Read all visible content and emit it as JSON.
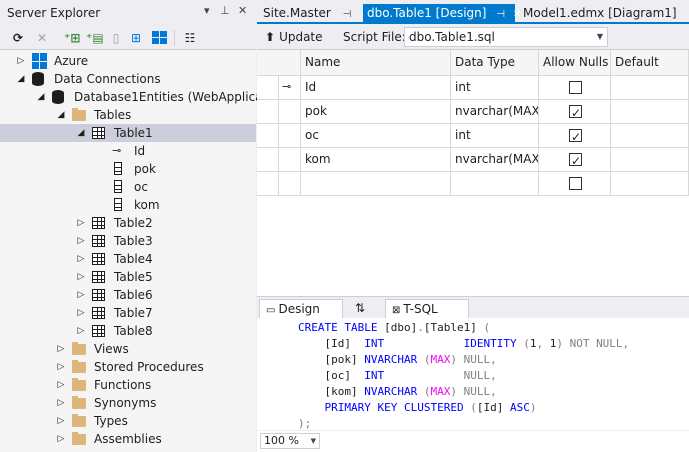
{
  "server_explorer": {
    "title": "Server Explorer",
    "title_controls": [
      "▾",
      "⊥",
      "✕"
    ],
    "toolbar_icons": [
      "refresh-icon",
      "stop-icon",
      "connect-to-database-icon",
      "connect-to-server-icon",
      "sharepoint-icon",
      "azure-icon",
      "properties-icon"
    ],
    "tree": [
      {
        "label": "Azure",
        "icon": "azure-icon",
        "level": 0,
        "arrow": "collapsed"
      },
      {
        "label": "Data Connections",
        "icon": "data-connections-icon",
        "level": 0,
        "arrow": "expanded"
      },
      {
        "label": "Database1Entities (WebApplicatio",
        "icon": "database-icon",
        "level": 1,
        "arrow": "expanded"
      },
      {
        "label": "Tables",
        "icon": "folder-icon",
        "level": 2,
        "arrow": "expanded"
      },
      {
        "label": "Table1",
        "icon": "table-icon",
        "level": 3,
        "arrow": "expanded",
        "selected": true
      },
      {
        "label": "Id",
        "icon": "key-icon",
        "level": 4,
        "arrow": "none"
      },
      {
        "label": "pok",
        "icon": "column-icon",
        "level": 4,
        "arrow": "none"
      },
      {
        "label": "oc",
        "icon": "column-icon",
        "level": 4,
        "arrow": "none"
      },
      {
        "label": "kom",
        "icon": "column-icon",
        "level": 4,
        "arrow": "none"
      },
      {
        "label": "Table2",
        "icon": "table-icon",
        "level": 3,
        "arrow": "collapsed"
      },
      {
        "label": "Table3",
        "icon": "table-icon",
        "level": 3,
        "arrow": "collapsed"
      },
      {
        "label": "Table4",
        "icon": "table-icon",
        "level": 3,
        "arrow": "collapsed"
      },
      {
        "label": "Table5",
        "icon": "table-icon",
        "level": 3,
        "arrow": "collapsed"
      },
      {
        "label": "Table6",
        "icon": "table-icon",
        "level": 3,
        "arrow": "collapsed"
      },
      {
        "label": "Table7",
        "icon": "table-icon",
        "level": 3,
        "arrow": "collapsed"
      },
      {
        "label": "Table8",
        "icon": "table-icon",
        "level": 3,
        "arrow": "collapsed"
      },
      {
        "label": "Views",
        "icon": "folder-icon",
        "level": 2,
        "arrow": "collapsed"
      },
      {
        "label": "Stored Procedures",
        "icon": "folder-icon",
        "level": 2,
        "arrow": "collapsed"
      },
      {
        "label": "Functions",
        "icon": "folder-icon",
        "level": 2,
        "arrow": "collapsed"
      },
      {
        "label": "Synonyms",
        "icon": "folder-icon",
        "level": 2,
        "arrow": "collapsed"
      },
      {
        "label": "Types",
        "icon": "folder-icon",
        "level": 2,
        "arrow": "collapsed"
      },
      {
        "label": "Assemblies",
        "icon": "folder-icon",
        "level": 2,
        "arrow": "collapsed"
      }
    ]
  },
  "tabs": [
    {
      "label": "Site.Master",
      "pin": "⊣",
      "active": false
    },
    {
      "label": "dbo.Table1 [Design]",
      "pin": "⊣",
      "close": "✕",
      "active": true
    },
    {
      "label": "Model1.edmx [Diagram1]",
      "active": false
    }
  ],
  "designer_toolbar": {
    "update_label": "Update",
    "script_file_label": "Script File:",
    "script_file_value": "dbo.Table1.sql"
  },
  "grid": {
    "headers": [
      "Name",
      "Data Type",
      "Allow Nulls",
      "Default"
    ],
    "rows": [
      {
        "key": true,
        "name": "Id",
        "type": "int",
        "nulls": false
      },
      {
        "key": false,
        "name": "pok",
        "type": "nvarchar(MAX)",
        "nulls": true
      },
      {
        "key": false,
        "name": "oc",
        "type": "int",
        "nulls": true
      },
      {
        "key": false,
        "name": "kom",
        "type": "nvarchar(MAX)",
        "nulls": true
      },
      {
        "key": false,
        "name": "",
        "type": "",
        "nulls": false
      }
    ]
  },
  "bottom_tabs": {
    "design": "Design",
    "swap": "⇅",
    "tsql": "T-SQL"
  },
  "sql_lines": [
    [
      [
        "kw",
        "CREATE TABLE "
      ],
      [
        "bk",
        "[dbo]"
      ],
      [
        "gy",
        "."
      ],
      [
        "bk",
        "[Table1]"
      ],
      [
        "gy",
        " ("
      ]
    ],
    [
      [
        "bk",
        "    [Id]  "
      ],
      [
        "kw",
        "INT"
      ],
      [
        "bk",
        "            "
      ],
      [
        "kw",
        "IDENTITY "
      ],
      [
        "gy",
        "("
      ],
      [
        "bk",
        "1"
      ],
      [
        "gy",
        ", "
      ],
      [
        "bk",
        "1"
      ],
      [
        "gy",
        ") NOT NULL,"
      ]
    ],
    [
      [
        "bk",
        "    [pok] "
      ],
      [
        "kw",
        "NVARCHAR "
      ],
      [
        "gy",
        "("
      ],
      [
        "mg",
        "MAX"
      ],
      [
        "gy",
        ") NULL,"
      ]
    ],
    [
      [
        "bk",
        "    [oc]  "
      ],
      [
        "kw",
        "INT"
      ],
      [
        "bk",
        "            "
      ],
      [
        "gy",
        "NULL,"
      ]
    ],
    [
      [
        "bk",
        "    [kom] "
      ],
      [
        "kw",
        "NVARCHAR "
      ],
      [
        "gy",
        "("
      ],
      [
        "mg",
        "MAX"
      ],
      [
        "gy",
        ") NULL,"
      ]
    ],
    [
      [
        "bk",
        "    "
      ],
      [
        "kw",
        "PRIMARY KEY CLUSTERED "
      ],
      [
        "gy",
        "("
      ],
      [
        "bk",
        "[Id] "
      ],
      [
        "kw",
        "ASC"
      ],
      [
        "gy",
        ")"
      ]
    ],
    [
      [
        "gy",
        ");"
      ]
    ]
  ],
  "zoom": "100 %"
}
